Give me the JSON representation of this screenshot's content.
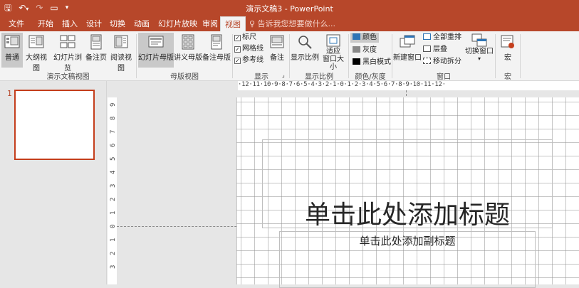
{
  "window": {
    "title": "演示文稿3 - PowerPoint"
  },
  "qat": {
    "save": "🖫",
    "undo": "↶",
    "undo_drop": "▾",
    "redo": "↷",
    "present": "▭",
    "customize": "▾"
  },
  "tabs": [
    {
      "label": "文件"
    },
    {
      "label": "开始"
    },
    {
      "label": "插入"
    },
    {
      "label": "设计"
    },
    {
      "label": "切换"
    },
    {
      "label": "动画"
    },
    {
      "label": "幻灯片放映"
    },
    {
      "label": "审阅"
    },
    {
      "label": "视图"
    }
  ],
  "tell_me": "♀ 告诉我您想要做什么...",
  "ribbon": {
    "presentation_views": {
      "label": "演示文稿视图",
      "buttons": [
        {
          "label": "普通",
          "icon": "normal-view-icon"
        },
        {
          "label": "大纲视图",
          "icon": "outline-view-icon"
        },
        {
          "label": "幻灯片浏览",
          "icon": "slide-sorter-icon"
        },
        {
          "label": "备注页",
          "icon": "notes-page-icon"
        },
        {
          "label": "阅读视图",
          "icon": "reading-view-icon"
        }
      ]
    },
    "master_views": {
      "label": "母版视图",
      "buttons": [
        {
          "label": "幻灯片母版",
          "icon": "slide-master-icon"
        },
        {
          "label": "讲义母版",
          "icon": "handout-master-icon"
        },
        {
          "label": "备注母版",
          "icon": "notes-master-icon"
        }
      ]
    },
    "show": {
      "label": "显示",
      "launcher": "⌟",
      "ruler": "标尺",
      "gridlines": "网格线",
      "guides": "参考线",
      "check": "✓",
      "notes": "备注"
    },
    "zoom": {
      "label": "显示比例",
      "zoom": "显示比例",
      "fit_line1": "适应",
      "fit_line2": "窗口大小"
    },
    "color": {
      "label": "颜色/灰度",
      "color": "颜色",
      "grayscale": "灰度",
      "bw": "黑白模式"
    },
    "window": {
      "label": "窗口",
      "new_window": "新建窗口",
      "arrange_all": "全部重排",
      "cascade": "层叠",
      "move_split": "移动拆分",
      "switch_line1": "切换窗口",
      "switch_line2": "▾"
    },
    "macros": {
      "label": "宏",
      "macros": "宏"
    }
  },
  "thumbnails": {
    "slide_number": "1"
  },
  "ruler": {
    "horizontal": "·12·11·10·9·8·7·6·5·4·3·2·1·0·1·2·3·4·5·6·7·8·9·10·11·12·",
    "vertical": [
      "9",
      "8",
      "7",
      "6",
      "5",
      "4",
      "3",
      "2",
      "1",
      "0",
      "1",
      "2",
      "3"
    ]
  },
  "slide": {
    "title_placeholder": "单击此处添加标题",
    "subtitle_placeholder": "单击此处添加副标题"
  }
}
